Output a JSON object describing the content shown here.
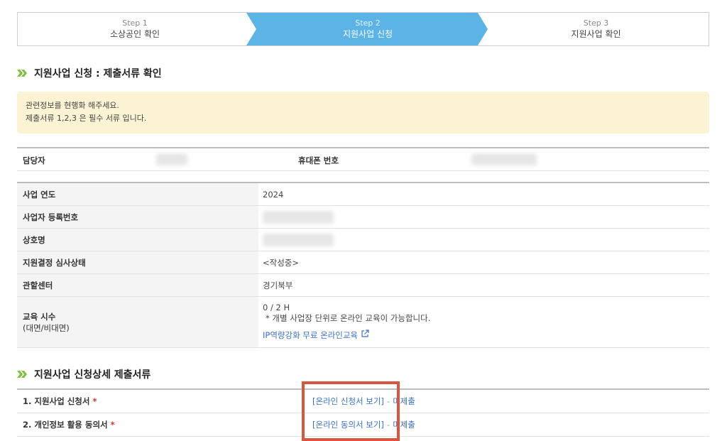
{
  "stepper": {
    "steps": [
      {
        "num": "Step 1",
        "title": "소상공인 확인"
      },
      {
        "num": "Step 2",
        "title": "지원사업 신청"
      },
      {
        "num": "Step 3",
        "title": "지원사업 확인"
      }
    ],
    "active_index": 1,
    "active_color": "#5bb3e6"
  },
  "section1": {
    "title": "지원사업 신청 : 제출서류 확인"
  },
  "notice": {
    "line1": "관련정보를 현행화 해주세요.",
    "line2": "제출서류 1,2,3 은 필수 서류 입니다."
  },
  "contact": {
    "manager_label": "담당자",
    "phone_label": "휴대폰 번호"
  },
  "info": {
    "rows": [
      {
        "label": "사업 연도",
        "value": "2024"
      },
      {
        "label": "사업자 등록번호",
        "value": ""
      },
      {
        "label": "상호명",
        "value": ""
      },
      {
        "label": "지원결정 심사상태",
        "value": "<작성중>"
      },
      {
        "label": "관할센터",
        "value": "경기북부"
      }
    ],
    "education": {
      "label_line1": "교육 시수",
      "label_line2": "(대면/비대면)",
      "hours": "0 / 2 H",
      "note": "* 개별 사업장 단위로 온라인 교육이 가능합니다.",
      "link": "IP역량강화 무료 온라인교육"
    }
  },
  "section2": {
    "title": "지원사업 신청상세 제출서류"
  },
  "docs": [
    {
      "label": "1. 지원사업 신청서",
      "required": "*",
      "link": "[온라인 신청서 보기]",
      "sep": "-",
      "status": "미제출"
    },
    {
      "label": "2. 개인정보 활용 동의서",
      "required": "*",
      "link": "[온라인 동의서 보기]",
      "sep": "-",
      "status": "미제출"
    }
  ],
  "colors": {
    "accent": "#5bb3e6",
    "section_chevron": "#7ec13f",
    "notice_bg": "#fcf3d4",
    "highlight_border": "#d9553d",
    "required": "#e0312d",
    "link": "#3a72c7"
  }
}
